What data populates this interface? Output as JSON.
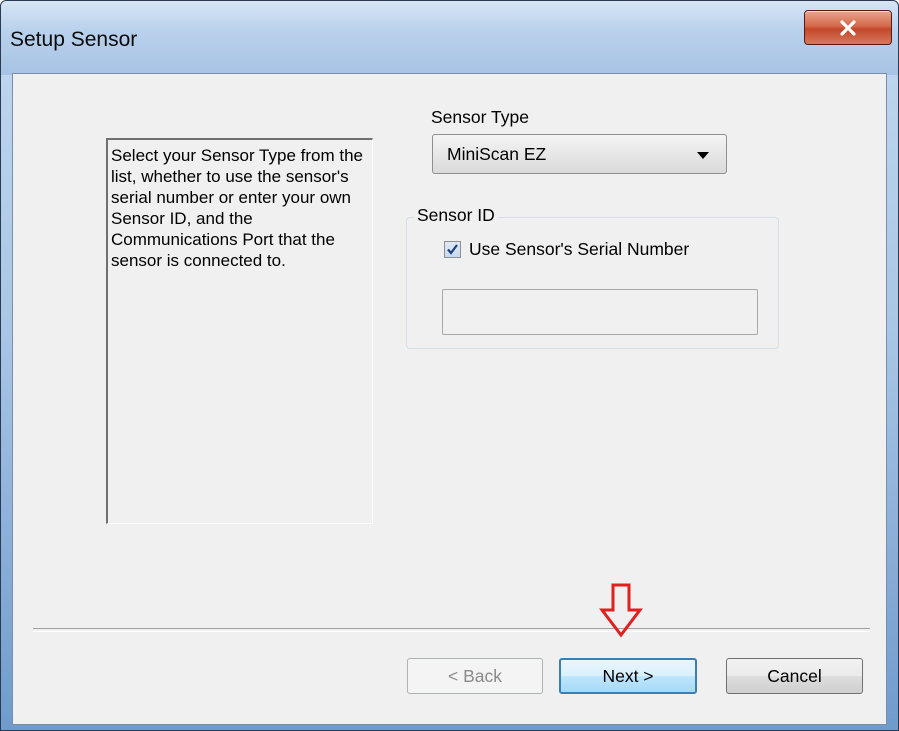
{
  "window": {
    "title": "Setup Sensor",
    "close_icon": "close-icon"
  },
  "info": {
    "text": "Select your Sensor Type from the list, whether to use the sensor's serial number or enter your own Sensor ID, and the Communications Port that the sensor is connected to."
  },
  "sensor_type": {
    "label": "Sensor Type",
    "selected": "MiniScan EZ"
  },
  "sensor_id": {
    "legend": "Sensor ID",
    "checkbox_label": "Use Sensor's Serial Number",
    "checked": true,
    "input_value": ""
  },
  "buttons": {
    "back": "< Back",
    "next": "Next >",
    "cancel": "Cancel"
  },
  "annotation": {
    "arrow_color": "#e02020"
  }
}
